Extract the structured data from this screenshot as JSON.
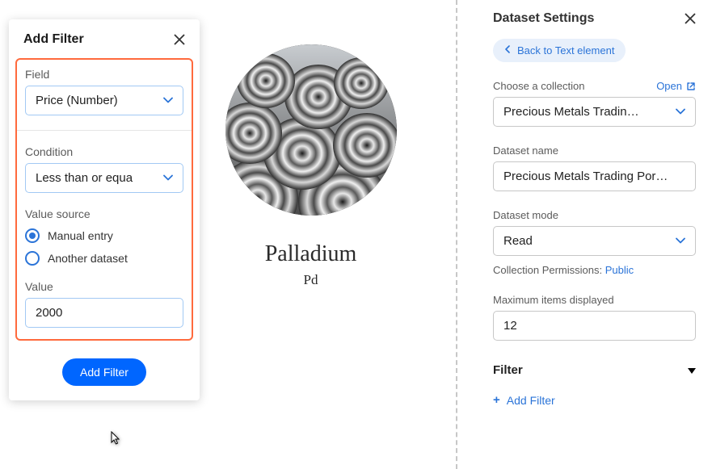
{
  "filter": {
    "title": "Add Filter",
    "field_label": "Field",
    "field_value": "Price (Number)",
    "condition_label": "Condition",
    "condition_value": "Less than or equa",
    "value_source_label": "Value source",
    "radio_manual": "Manual entry",
    "radio_another": "Another dataset",
    "value_label": "Value",
    "value_input": "2000",
    "submit": "Add Filter"
  },
  "card": {
    "name": "Palladium",
    "symbol": "Pd"
  },
  "settings": {
    "title": "Dataset Settings",
    "back": "Back to Text element",
    "collection_label": "Choose a collection",
    "open": "Open",
    "collection_value": "Precious Metals Tradin…",
    "dataset_name_label": "Dataset name",
    "dataset_name_value": "Precious Metals Trading Por…",
    "mode_label": "Dataset mode",
    "mode_value": "Read",
    "permissions_label": "Collection Permissions: ",
    "permissions_value": "Public",
    "max_label": "Maximum items displayed",
    "max_value": "12",
    "filter_heading": "Filter",
    "add_filter": "Add Filter"
  }
}
